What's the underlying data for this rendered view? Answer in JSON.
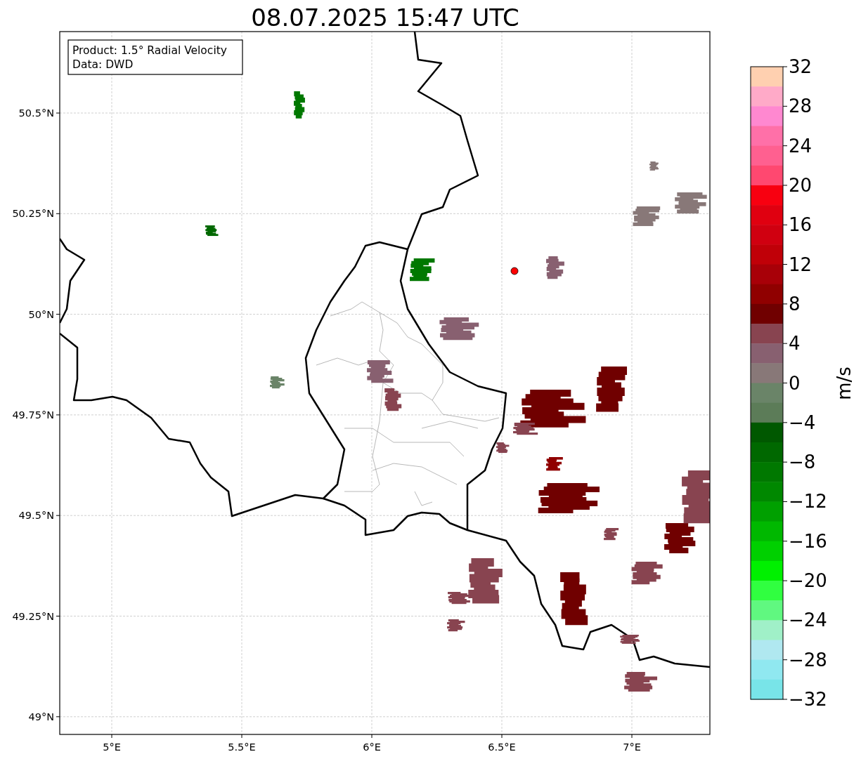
{
  "title": "08.07.2025 15:47 UTC",
  "info_box": [
    "Product: 1.5° Radial Velocity",
    "Data: DWD"
  ],
  "map": {
    "lon_ticks": [
      "5°E",
      "5.5°E",
      "6°E",
      "6.5°E",
      "7°E"
    ],
    "lat_ticks": [
      "50.5°N",
      "50.25°N",
      "50°N",
      "49.75°N",
      "49.5°N",
      "49.25°N",
      "49°N"
    ]
  },
  "colorbar": {
    "label": "m/s",
    "ticks": [
      "32",
      "28",
      "24",
      "20",
      "16",
      "12",
      "8",
      "4",
      "0",
      "−4",
      "−8",
      "−12",
      "−16",
      "−20",
      "−24",
      "−28",
      "−32"
    ],
    "bands": [
      {
        "color": "#ffd0b0"
      },
      {
        "color": "#ffaac8"
      },
      {
        "color": "#ff88d0"
      },
      {
        "color": "#ff70a8"
      },
      {
        "color": "#ff6090"
      },
      {
        "color": "#ff4870"
      },
      {
        "color": "#f80010"
      },
      {
        "color": "#e00010"
      },
      {
        "color": "#d00010"
      },
      {
        "color": "#c00008"
      },
      {
        "color": "#a80008"
      },
      {
        "color": "#900000"
      },
      {
        "color": "#700000"
      },
      {
        "color": "#884450"
      },
      {
        "color": "#886070"
      },
      {
        "color": "#887878"
      },
      {
        "color": "#6a8468"
      },
      {
        "color": "#5c7c58"
      },
      {
        "color": "#005800"
      },
      {
        "color": "#006800"
      },
      {
        "color": "#007800"
      },
      {
        "color": "#008800"
      },
      {
        "color": "#00a000"
      },
      {
        "color": "#00b800"
      },
      {
        "color": "#00d000"
      },
      {
        "color": "#00f000"
      },
      {
        "color": "#30ff40"
      },
      {
        "color": "#60f880"
      },
      {
        "color": "#a0f0c8"
      },
      {
        "color": "#b0e8f0"
      },
      {
        "color": "#90e8f0"
      },
      {
        "color": "#78e4e8"
      }
    ]
  }
}
